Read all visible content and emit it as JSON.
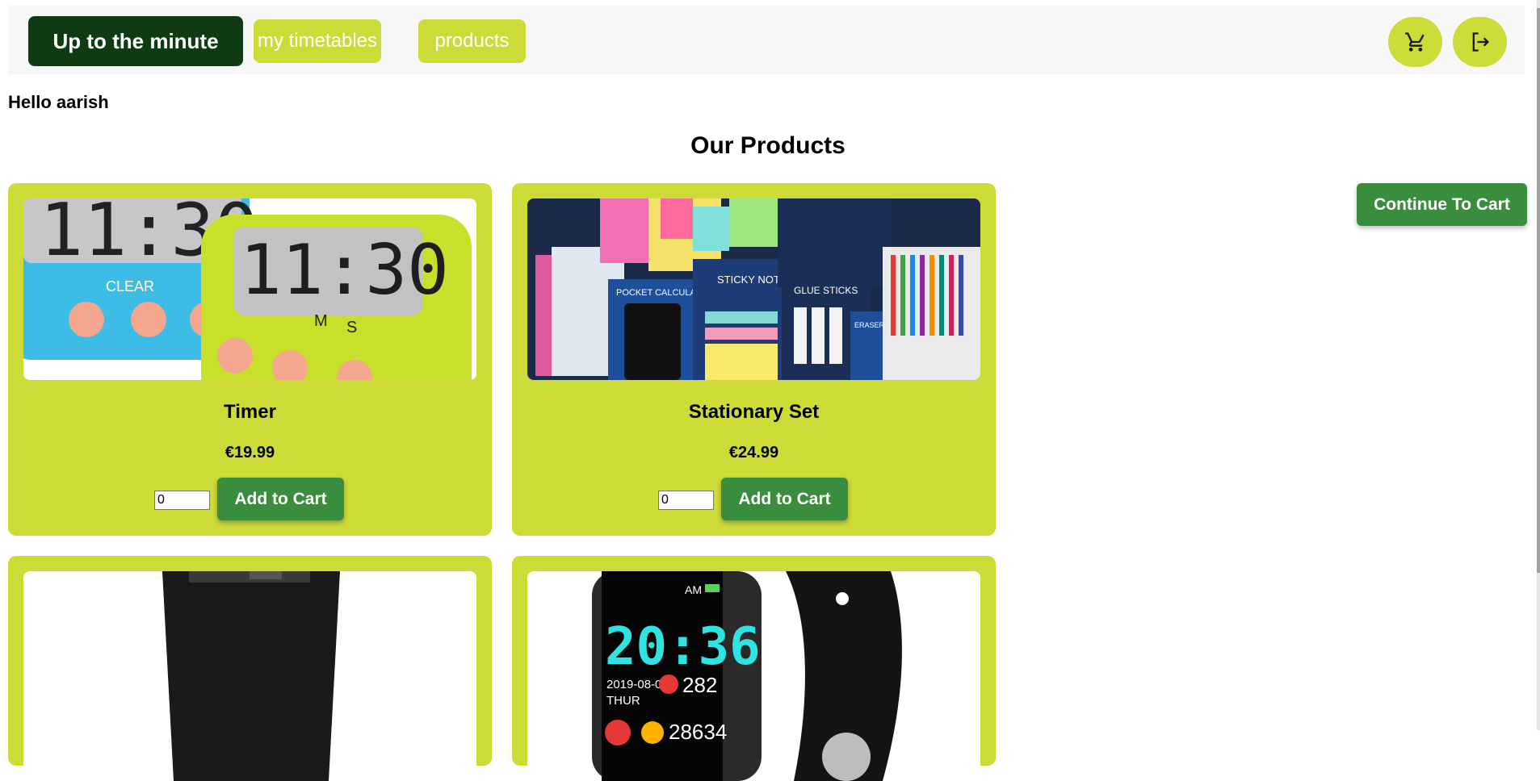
{
  "nav": {
    "brand": "Up to the minute",
    "links": [
      {
        "label": "my timetables"
      },
      {
        "label": "products"
      }
    ],
    "cart_icon": "cart-icon",
    "logout_icon": "logout-icon"
  },
  "greeting": "Hello aarish",
  "heading": "Our Products",
  "continue_button": "Continue To Cart",
  "products": [
    {
      "name": "Timer",
      "price": "€19.99",
      "quantity": "0",
      "button": "Add to Cart",
      "image": "timer-image"
    },
    {
      "name": "Stationary Set",
      "price": "€24.99",
      "quantity": "0",
      "button": "Add to Cart",
      "image": "stationery-image"
    },
    {
      "name": "",
      "price": "",
      "quantity": "",
      "button": "",
      "image": "tumbler-image"
    },
    {
      "name": "",
      "price": "",
      "quantity": "",
      "button": "",
      "image": "smartwatch-image"
    }
  ],
  "watch_display": {
    "time": "20:36",
    "am": "AM",
    "date": "2019-08-07",
    "day": "THUR",
    "heart": "282",
    "steps": "28634"
  },
  "timer_display": {
    "digits": "11:30",
    "clear": "CLEAR",
    "m": "M",
    "s": "S"
  },
  "stationery_labels": {
    "calculator": "POCKET CALCULATOR",
    "sticky": "STICKY NOTEPADS",
    "glue": "GLUE STICKS",
    "eraser": "ERASER & SHARPENER"
  },
  "colors": {
    "accent": "#ccdb37",
    "brand_bg": "#0e3b14",
    "button": "#3a8d3d"
  }
}
